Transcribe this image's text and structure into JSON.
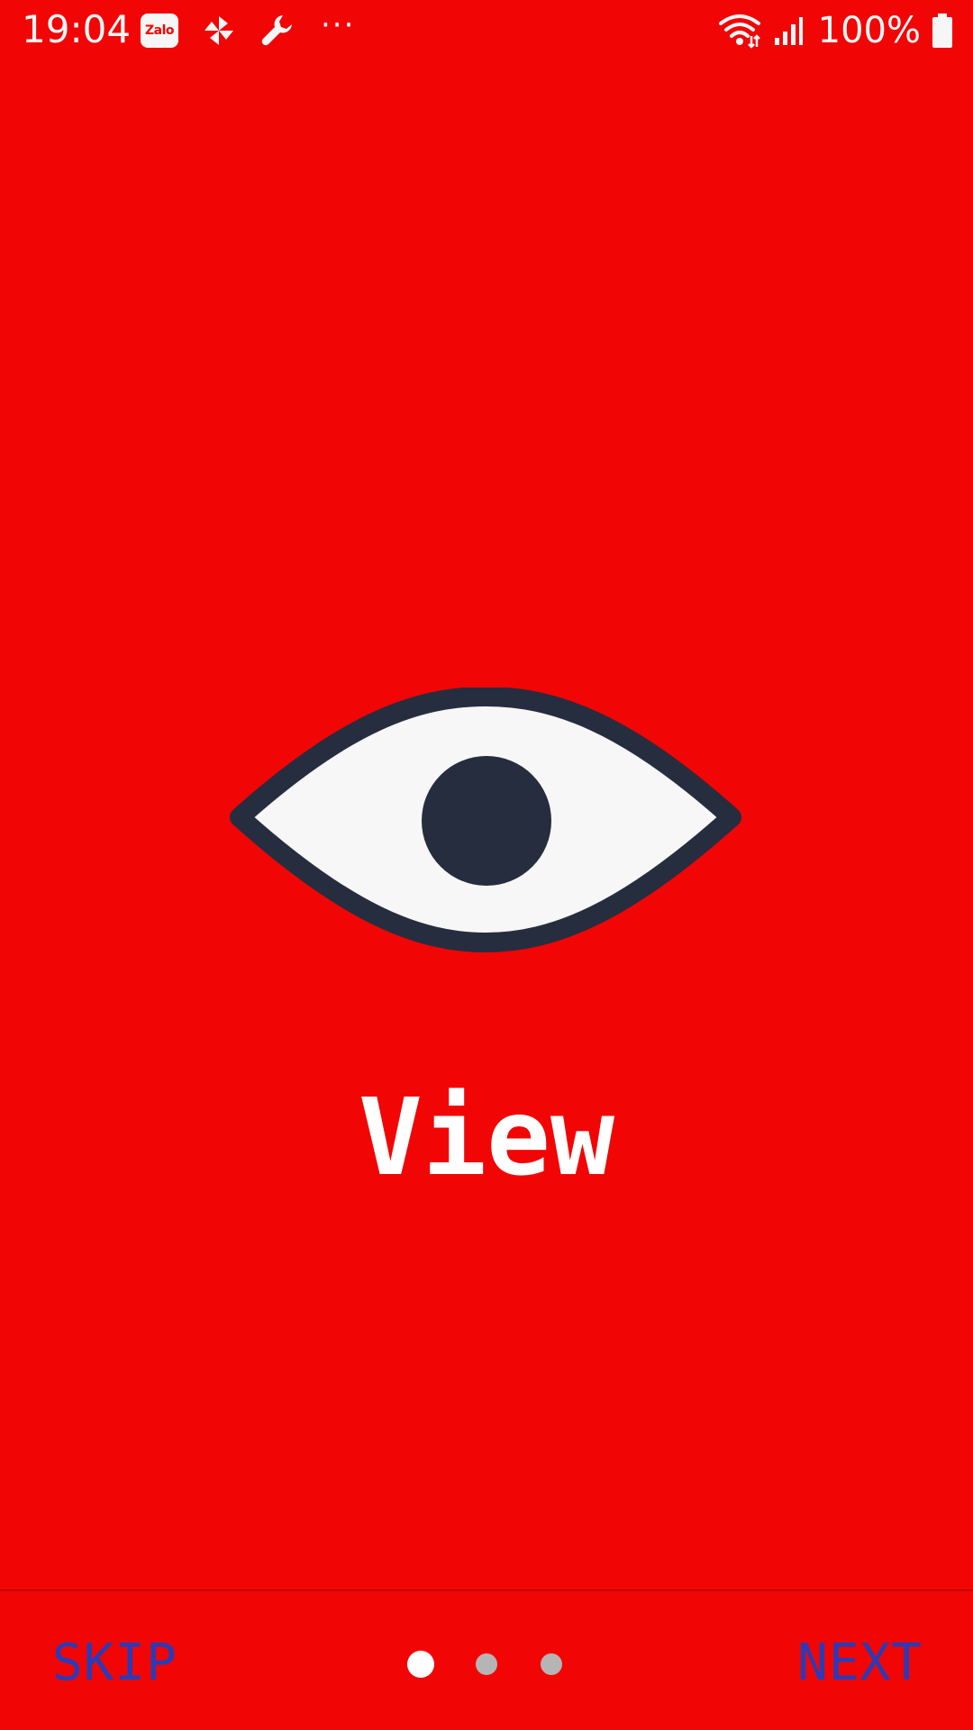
{
  "status_bar": {
    "time": "19:04",
    "battery_level": "100%",
    "left_icons": [
      "zalo-icon",
      "pinwheel-icon",
      "wrench-icon",
      "more-dots-icon"
    ],
    "right_icons": [
      "wifi-icon",
      "signal-icon",
      "battery-icon"
    ],
    "zalo_label": "Zalo",
    "more_label": "···"
  },
  "onboarding": {
    "illustration": "eye-icon",
    "title": "View",
    "background_color": "#f20505"
  },
  "navigation": {
    "skip_label": "SKIP",
    "next_label": "NEXT",
    "page_count": 3,
    "current_page": 1
  }
}
